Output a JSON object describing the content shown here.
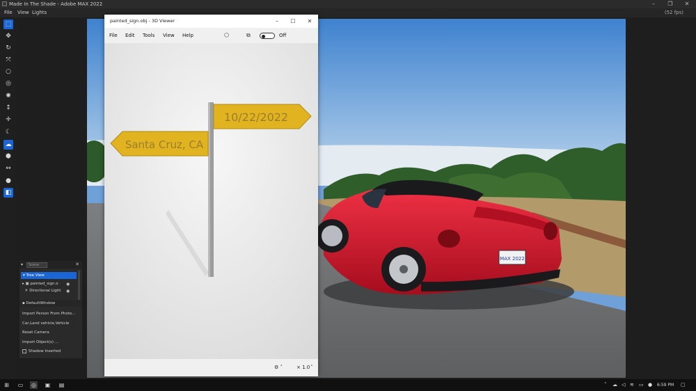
{
  "app": {
    "title": "Made In The Shade - Adobe MAX 2022",
    "menu": [
      "File",
      "View",
      "Lights"
    ],
    "fps": "(52 fps)",
    "minimize": "–",
    "maximize": "❐",
    "close": "✕"
  },
  "toolbar": {
    "tools": [
      {
        "name": "select-tool-icon",
        "glyph": "⬚",
        "active": true
      },
      {
        "name": "move-tool-icon",
        "glyph": "✥",
        "active": false
      },
      {
        "name": "rotate-tool-icon",
        "glyph": "↻",
        "active": false
      },
      {
        "name": "scale-tool-icon",
        "glyph": "⤧",
        "active": false
      },
      {
        "name": "orbit-tool-icon",
        "glyph": "○",
        "active": false
      },
      {
        "name": "target-tool-icon",
        "glyph": "◎",
        "active": false
      },
      {
        "name": "light-tool-icon",
        "glyph": "✺",
        "active": false
      },
      {
        "name": "height-tool-icon",
        "glyph": "↕",
        "active": false
      },
      {
        "name": "pan-tool-icon",
        "glyph": "✛",
        "active": false
      },
      {
        "name": "moon-tool-icon",
        "glyph": "☾",
        "active": false
      },
      {
        "name": "shade-tool-icon",
        "glyph": "☁",
        "active": true
      },
      {
        "name": "cube-tool-icon",
        "glyph": "⬢",
        "active": false
      },
      {
        "name": "measure-tool-icon",
        "glyph": "↔",
        "active": false
      },
      {
        "name": "sphere-tool-icon",
        "glyph": "●",
        "active": false
      },
      {
        "name": "render-tool-icon",
        "glyph": "◧",
        "active": true
      }
    ]
  },
  "scene_panel": {
    "search_placeholder": "Scene",
    "tree_view_label": "Tree View",
    "items": [
      "painted_sign.o",
      "Directional Light"
    ],
    "section_label": "DefaultWindow",
    "actions": [
      "Import Person From Photo...",
      "Car,Land vehicle,Vehicle",
      "Reset Camera",
      "Import Object(s) ..."
    ],
    "shadow_label": "Shadow Inserted"
  },
  "viewer": {
    "title": "painted_sign.obj - 3D Viewer",
    "menu": [
      "File",
      "Edit",
      "Tools",
      "View",
      "Help"
    ],
    "toggle_label": "Off",
    "zoom": "× 1.0",
    "sign_left_text": "Santa Cruz, CA",
    "sign_right_text": "10/22/2022"
  },
  "scene": {
    "license_plate": "MAX 2022"
  },
  "taskbar": {
    "time": "6:59 PM"
  },
  "colors": {
    "accent": "#1b66d6",
    "sign_yellow": "#e2b320",
    "car_red": "#d4132b",
    "sky": "#5b97d6"
  }
}
